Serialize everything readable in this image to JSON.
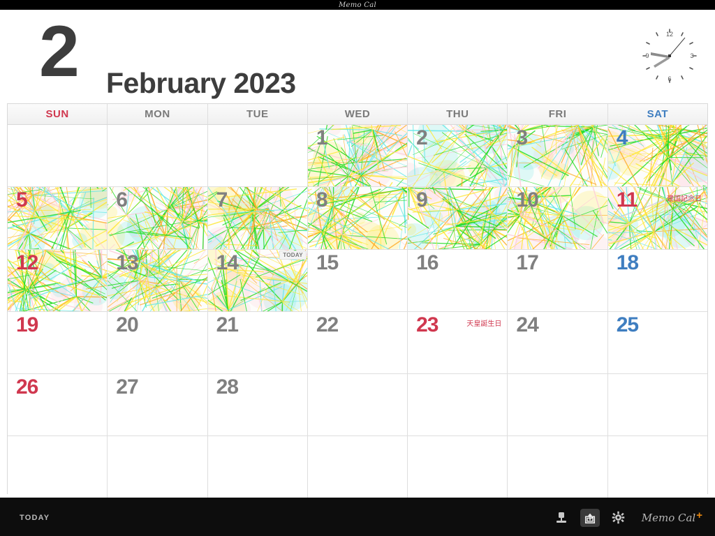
{
  "window": {
    "title": "Memo Cal"
  },
  "header": {
    "month_number": "2",
    "month_label": "February 2023",
    "clock": {
      "name": "analog-clock",
      "numerals": [
        "12",
        "3",
        "6",
        "9"
      ],
      "hour_hand_deg": 278,
      "minute_hand_deg": 250,
      "second_hand_deg": 30
    }
  },
  "calendar": {
    "day_headers": [
      {
        "label": "SUN",
        "kind": "sun"
      },
      {
        "label": "MON",
        "kind": "weekday"
      },
      {
        "label": "TUE",
        "kind": "weekday"
      },
      {
        "label": "WED",
        "kind": "weekday"
      },
      {
        "label": "THU",
        "kind": "weekday"
      },
      {
        "label": "FRI",
        "kind": "weekday"
      },
      {
        "label": "SAT",
        "kind": "sat"
      }
    ],
    "today_badge_label": "TODAY",
    "weeks": [
      [
        {
          "day": "",
          "kind": "blank",
          "memo": false
        },
        {
          "day": "",
          "kind": "blank",
          "memo": false
        },
        {
          "day": "",
          "kind": "blank",
          "memo": false
        },
        {
          "day": "1",
          "kind": "weekday",
          "memo": true
        },
        {
          "day": "2",
          "kind": "weekday",
          "memo": true
        },
        {
          "day": "3",
          "kind": "weekday",
          "memo": true
        },
        {
          "day": "4",
          "kind": "sat",
          "memo": true
        }
      ],
      [
        {
          "day": "5",
          "kind": "sun",
          "memo": true
        },
        {
          "day": "6",
          "kind": "weekday",
          "memo": true
        },
        {
          "day": "7",
          "kind": "weekday",
          "memo": true
        },
        {
          "day": "8",
          "kind": "weekday",
          "memo": true
        },
        {
          "day": "9",
          "kind": "weekday",
          "memo": true
        },
        {
          "day": "10",
          "kind": "weekday",
          "memo": true
        },
        {
          "day": "11",
          "kind": "holiday",
          "memo": true,
          "holiday": "建国記念日"
        }
      ],
      [
        {
          "day": "12",
          "kind": "sun",
          "memo": true
        },
        {
          "day": "13",
          "kind": "weekday",
          "memo": true
        },
        {
          "day": "14",
          "kind": "weekday",
          "memo": true,
          "today": true
        },
        {
          "day": "15",
          "kind": "weekday",
          "memo": false
        },
        {
          "day": "16",
          "kind": "weekday",
          "memo": false
        },
        {
          "day": "17",
          "kind": "weekday",
          "memo": false
        },
        {
          "day": "18",
          "kind": "sat",
          "memo": false
        }
      ],
      [
        {
          "day": "19",
          "kind": "sun",
          "memo": false
        },
        {
          "day": "20",
          "kind": "weekday",
          "memo": false
        },
        {
          "day": "21",
          "kind": "weekday",
          "memo": false
        },
        {
          "day": "22",
          "kind": "weekday",
          "memo": false
        },
        {
          "day": "23",
          "kind": "holiday",
          "memo": false,
          "holiday": "天皇誕生日"
        },
        {
          "day": "24",
          "kind": "weekday",
          "memo": false
        },
        {
          "day": "25",
          "kind": "sat",
          "memo": false
        }
      ],
      [
        {
          "day": "26",
          "kind": "sun",
          "memo": false
        },
        {
          "day": "27",
          "kind": "weekday",
          "memo": false
        },
        {
          "day": "28",
          "kind": "weekday",
          "memo": false
        },
        {
          "day": "",
          "kind": "blank",
          "memo": false
        },
        {
          "day": "",
          "kind": "blank",
          "memo": false
        },
        {
          "day": "",
          "kind": "blank",
          "memo": false
        },
        {
          "day": "",
          "kind": "blank",
          "memo": false
        }
      ],
      [
        {
          "day": "",
          "kind": "blank",
          "memo": false
        },
        {
          "day": "",
          "kind": "blank",
          "memo": false
        },
        {
          "day": "",
          "kind": "blank",
          "memo": false
        },
        {
          "day": "",
          "kind": "blank",
          "memo": false
        },
        {
          "day": "",
          "kind": "blank",
          "memo": false
        },
        {
          "day": "",
          "kind": "blank",
          "memo": false
        },
        {
          "day": "",
          "kind": "blank",
          "memo": false
        }
      ]
    ]
  },
  "toolbar": {
    "today_label": "TODAY",
    "icons": [
      "stamp-icon",
      "share-icon",
      "gear-icon"
    ],
    "brand_text": "Memo Cal",
    "brand_plus": "+"
  },
  "colors": {
    "sunday": "#d0384f",
    "saturday": "#3f7ec0",
    "weekday": "#808080",
    "header_text": "#3d3d3d",
    "toolbar_bg": "#0d0d0d",
    "brand_accent": "#e8870f",
    "memo_green": "#22dd22",
    "memo_yellow": "#ffe833",
    "memo_cyan": "#66e8e8",
    "memo_orange": "#ffaa22",
    "memo_pink": "#ffc8d8"
  }
}
